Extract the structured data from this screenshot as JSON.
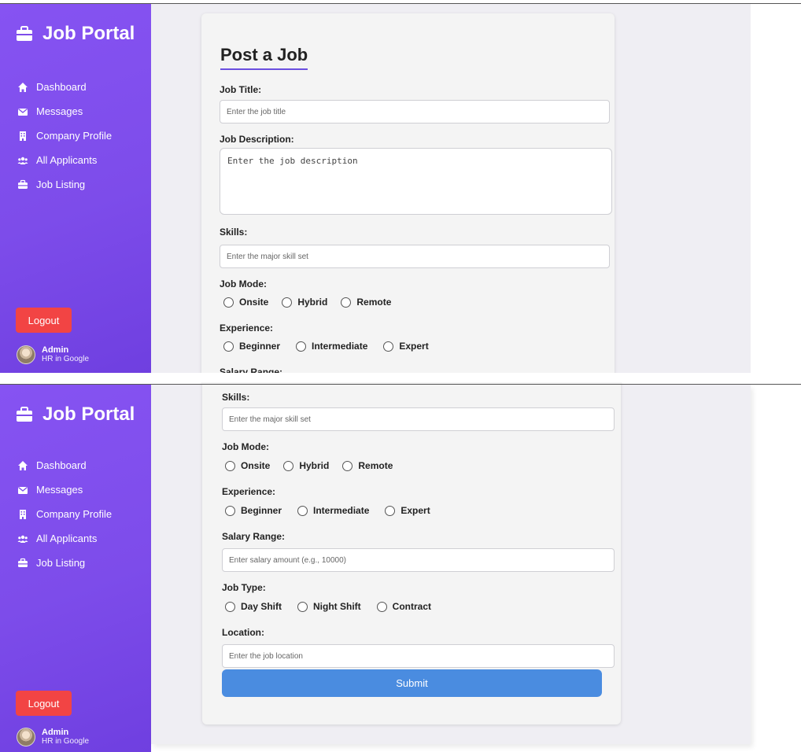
{
  "sidebar": {
    "brand": "Job Portal",
    "items": [
      {
        "label": "Dashboard"
      },
      {
        "label": "Messages"
      },
      {
        "label": "Company Profile"
      },
      {
        "label": "All Applicants"
      },
      {
        "label": "Job Listing"
      }
    ],
    "logout_label": "Logout",
    "user": {
      "name": "Admin",
      "role": "HR in Google"
    }
  },
  "form": {
    "heading": "Post a Job",
    "job_title": {
      "label": "Job Title:",
      "placeholder": "Enter the job title"
    },
    "job_description": {
      "label": "Job Description:",
      "placeholder": "Enter the job description"
    },
    "skills": {
      "label": "Skills:",
      "placeholder": "Enter the major skill set"
    },
    "job_mode": {
      "label": "Job Mode:",
      "options": [
        "Onsite",
        "Hybrid",
        "Remote"
      ]
    },
    "experience": {
      "label": "Experience:",
      "options": [
        "Beginner",
        "Intermediate",
        "Expert"
      ]
    },
    "salary_range": {
      "label": "Salary Range:",
      "placeholder": "Enter salary amount (e.g., 10000)"
    },
    "job_type": {
      "label": "Job Type:",
      "options": [
        "Day Shift",
        "Night Shift",
        "Contract"
      ]
    },
    "location": {
      "label": "Location:",
      "placeholder": "Enter the job location"
    },
    "submit_label": "Submit"
  },
  "colors": {
    "sidebar": "#8653f2",
    "logout": "#f24444",
    "submit": "#4a8ce0",
    "accent_underline": "#6b4fe0"
  }
}
